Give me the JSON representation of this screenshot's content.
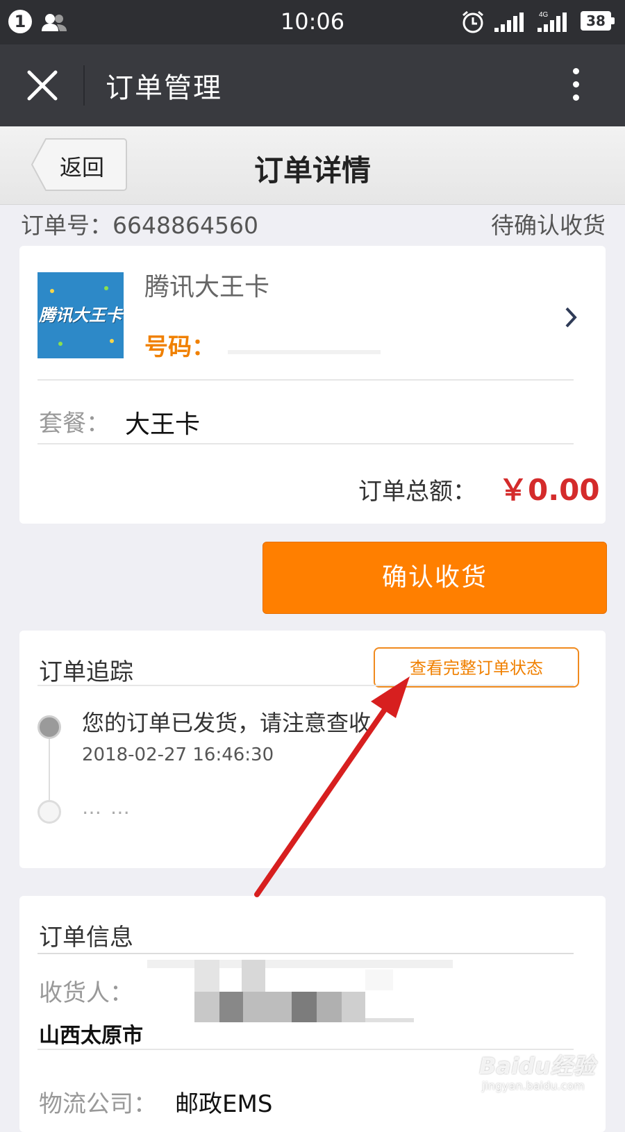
{
  "status_bar": {
    "notification_count": "1",
    "time": "10:06",
    "network": "4G",
    "battery": "38",
    "icons": [
      "users-icon",
      "alarm-icon",
      "signal-icon",
      "signal-4g-icon",
      "battery-icon"
    ]
  },
  "title_bar": {
    "title": "订单管理",
    "close_icon": "close-icon",
    "more_icon": "more-icon"
  },
  "page_header": {
    "back_label": "返回",
    "title": "订单详情"
  },
  "order": {
    "number_text": "订单号：6648864560",
    "status": "待确认收货",
    "product_name": "腾讯大王卡",
    "thumb_text": "腾讯大王卡",
    "phone_label": "号码：",
    "plan_label": "套餐：",
    "plan_value": "大王卡",
    "total_label": "订单总额：",
    "total_value": "￥0.00"
  },
  "confirm_button": "确认收货",
  "tracking": {
    "title": "订单追踪",
    "view_full_button": "查看完整订单状态",
    "events": [
      {
        "text": "您的订单已发货，请注意查收",
        "time": "2018-02-27 16:46:30"
      }
    ],
    "more": "… …"
  },
  "order_info": {
    "title": "订单信息",
    "receiver_label": "收货人：",
    "address": "山西太原市",
    "logistics_label": "物流公司：",
    "logistics_value": "邮政EMS"
  },
  "watermark": {
    "brand": "Baidu经验",
    "url": "jingyan.baidu.com"
  },
  "colors": {
    "accent_orange": "#ff7f00",
    "price_red": "#d42b2b",
    "annotation_arrow": "#d71f1f"
  }
}
